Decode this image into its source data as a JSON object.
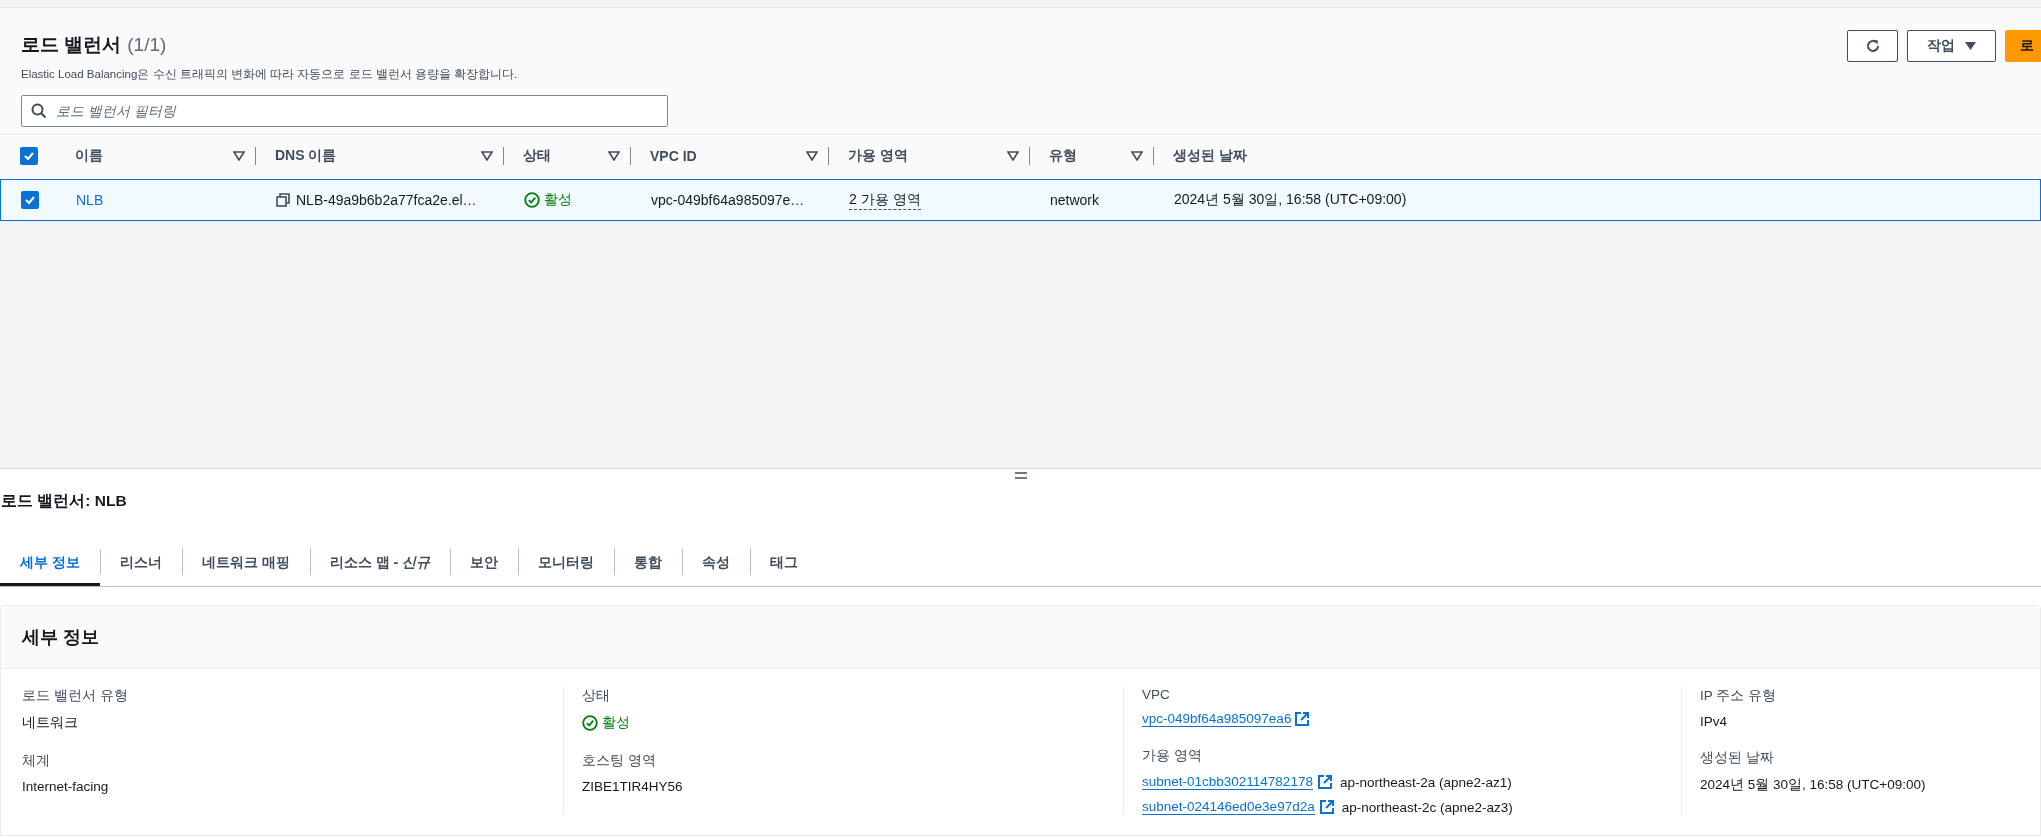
{
  "header": {
    "title": "로드 밸런서",
    "count": "(1/1)",
    "description": "Elastic Load Balancing은 수신 트래픽의 변화에 따라 자동으로 로드 밸런서 용량을 확장합니다.",
    "actions_button": "작업",
    "create_button": "로"
  },
  "search": {
    "placeholder": "로드 밸런서 필터링"
  },
  "table": {
    "select_all_checked": true,
    "columns": [
      "이름",
      "DNS 이름",
      "상태",
      "VPC ID",
      "가용 영역",
      "유형",
      "생성된 날짜"
    ],
    "rows": [
      {
        "selected": true,
        "name": "NLB",
        "dns": "NLB-49a9b6b2a77fca2e.el…",
        "status": "활성",
        "vpc_id": "vpc-049bf64a985097e…",
        "zones": "2 가용 영역",
        "type": "network",
        "created": "2024년 5월 30일, 16:58 (UTC+09:00)"
      }
    ]
  },
  "details": {
    "title": "로드 밸런서: NLB",
    "tabs": [
      {
        "label": "세부 정보",
        "selected": true
      },
      {
        "label": "리스너",
        "selected": false
      },
      {
        "label": "네트워크 매핑",
        "selected": false
      },
      {
        "label": "리소스 맵 - *신규*",
        "selected": false
      },
      {
        "label": "보안",
        "selected": false
      },
      {
        "label": "모니터링",
        "selected": false
      },
      {
        "label": "통합",
        "selected": false
      },
      {
        "label": "속성",
        "selected": false
      },
      {
        "label": "태그",
        "selected": false
      }
    ],
    "section_title": "세부 정보",
    "columns": [
      [
        {
          "kind": "text",
          "label": "로드 밸런서 유형",
          "value": "네트워크"
        },
        {
          "kind": "text",
          "label": "체계",
          "value": "Internet-facing"
        }
      ],
      [
        {
          "kind": "status",
          "label": "상태",
          "value": "활성"
        },
        {
          "kind": "text",
          "label": "호스팅 영역",
          "value": "ZIBE1TIR4HY56"
        }
      ],
      [
        {
          "kind": "link",
          "label": "VPC",
          "value": "vpc-049bf64a985097ea6"
        },
        {
          "kind": "subnets",
          "label": "가용 영역",
          "subnets": [
            {
              "link": "subnet-01cbb302114782178",
              "zone": "ap-northeast-2a (apne2-az1)"
            },
            {
              "link": "subnet-024146ed0e3e97d2a",
              "zone": "ap-northeast-2c (apne2-az3)"
            }
          ]
        }
      ],
      [
        {
          "kind": "text",
          "label": "IP 주소 유형",
          "value": "IPv4"
        },
        {
          "kind": "text",
          "label": "생성된 날짜",
          "value": "2024년 5월 30일, 16:58 (UTC+09:00)"
        }
      ]
    ]
  }
}
